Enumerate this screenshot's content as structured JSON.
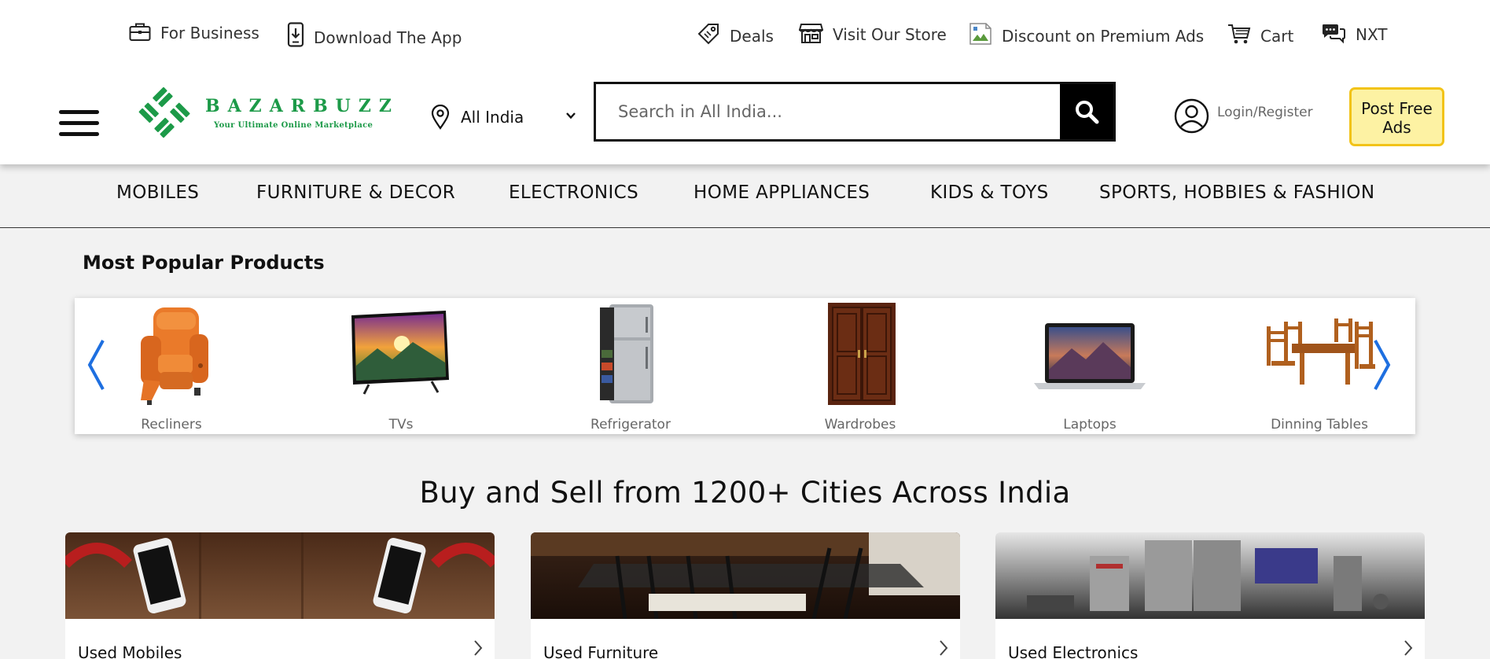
{
  "topbar": {
    "for_business": "For Business",
    "download_app": "Download The App",
    "deals": "Deals",
    "visit_store": "Visit Our Store",
    "discount_ads": "Discount on Premium Ads",
    "cart": "Cart",
    "nxt": "NXT"
  },
  "logo": {
    "word": "BAZARBUZZ",
    "tagline": "Your Ultimate Online Marketplace"
  },
  "location": {
    "selected": "All India"
  },
  "search": {
    "placeholder": "Search in All India..."
  },
  "account": {
    "login_label": "Login/Register"
  },
  "post_ad": {
    "label": "Post Free Ads"
  },
  "categories": [
    "MOBILES",
    "FURNITURE & DECOR",
    "ELECTRONICS",
    "HOME APPLIANCES",
    "KIDS & TOYS",
    "SPORTS, HOBBIES & FASHION"
  ],
  "popular": {
    "title": "Most Popular Products",
    "items": [
      "Recliners",
      "TVs",
      "Refrigerator",
      "Wardrobes",
      "Laptops",
      "Dinning Tables"
    ]
  },
  "cities": {
    "heading": "Buy and Sell from 1200+ Cities Across India"
  },
  "cards": [
    "Used Mobiles",
    "Used Furniture",
    "Used Electronics"
  ],
  "colors": {
    "brand_green": "#1c9a48",
    "post_ad_bg": "#fdf2a3",
    "post_ad_border": "#f2c318",
    "carousel_arrow": "#1e6fe0",
    "search_button": "#000000"
  },
  "icons": {
    "for_business": "briefcase-icon",
    "download_app": "phone-download-icon",
    "deals": "tag-icon",
    "visit_store": "store-icon",
    "discount_ads": "broken-image-icon",
    "cart": "cart-icon",
    "nxt": "chat-bubbles-icon",
    "location": "map-pin-icon",
    "search": "search-icon",
    "account": "user-circle-icon"
  }
}
